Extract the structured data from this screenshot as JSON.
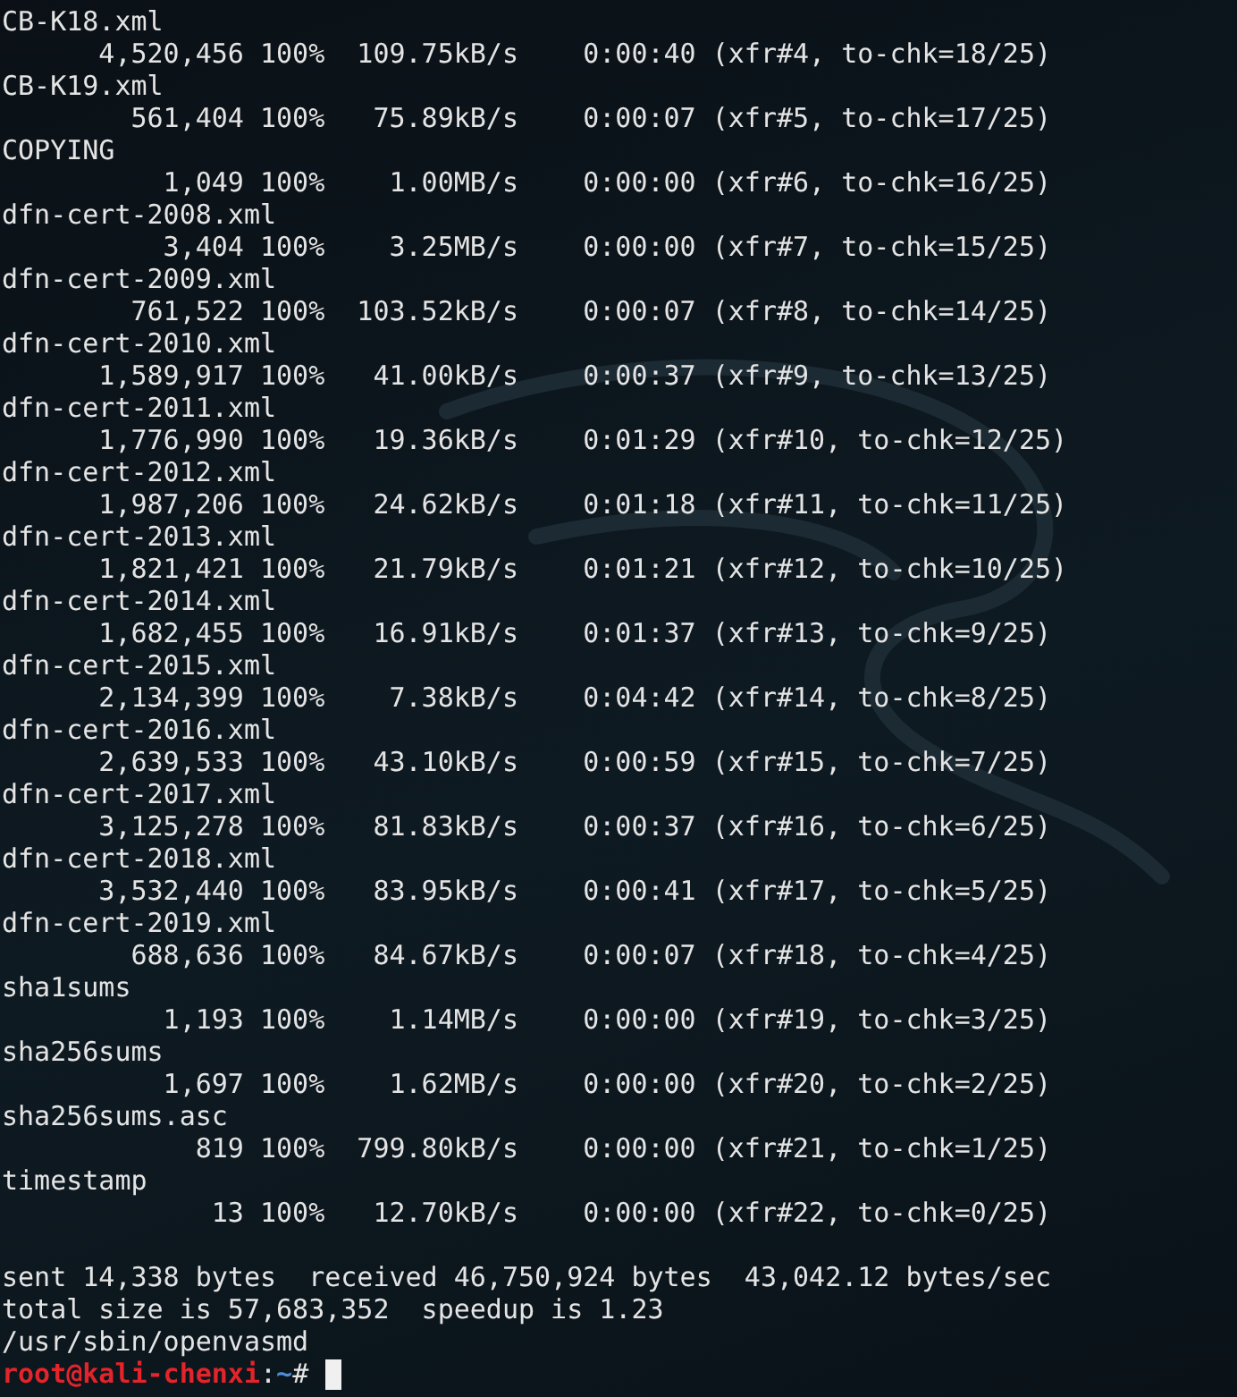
{
  "terminal": {
    "lines": [
      {
        "kind": "text",
        "text": "CB-K18.xml"
      },
      {
        "kind": "text",
        "text": "      4,520,456 100%  109.75kB/s    0:00:40 (xfr#4, to-chk=18/25)"
      },
      {
        "kind": "text",
        "text": "CB-K19.xml"
      },
      {
        "kind": "text",
        "text": "        561,404 100%   75.89kB/s    0:00:07 (xfr#5, to-chk=17/25)"
      },
      {
        "kind": "text",
        "text": "COPYING"
      },
      {
        "kind": "text",
        "text": "          1,049 100%    1.00MB/s    0:00:00 (xfr#6, to-chk=16/25)"
      },
      {
        "kind": "text",
        "text": "dfn-cert-2008.xml"
      },
      {
        "kind": "text",
        "text": "          3,404 100%    3.25MB/s    0:00:00 (xfr#7, to-chk=15/25)"
      },
      {
        "kind": "text",
        "text": "dfn-cert-2009.xml"
      },
      {
        "kind": "text",
        "text": "        761,522 100%  103.52kB/s    0:00:07 (xfr#8, to-chk=14/25)"
      },
      {
        "kind": "text",
        "text": "dfn-cert-2010.xml"
      },
      {
        "kind": "text",
        "text": "      1,589,917 100%   41.00kB/s    0:00:37 (xfr#9, to-chk=13/25)"
      },
      {
        "kind": "text",
        "text": "dfn-cert-2011.xml"
      },
      {
        "kind": "text",
        "text": "      1,776,990 100%   19.36kB/s    0:01:29 (xfr#10, to-chk=12/25)"
      },
      {
        "kind": "text",
        "text": "dfn-cert-2012.xml"
      },
      {
        "kind": "text",
        "text": "      1,987,206 100%   24.62kB/s    0:01:18 (xfr#11, to-chk=11/25)"
      },
      {
        "kind": "text",
        "text": "dfn-cert-2013.xml"
      },
      {
        "kind": "text",
        "text": "      1,821,421 100%   21.79kB/s    0:01:21 (xfr#12, to-chk=10/25)"
      },
      {
        "kind": "text",
        "text": "dfn-cert-2014.xml"
      },
      {
        "kind": "text",
        "text": "      1,682,455 100%   16.91kB/s    0:01:37 (xfr#13, to-chk=9/25)"
      },
      {
        "kind": "text",
        "text": "dfn-cert-2015.xml"
      },
      {
        "kind": "text",
        "text": "      2,134,399 100%    7.38kB/s    0:04:42 (xfr#14, to-chk=8/25)"
      },
      {
        "kind": "text",
        "text": "dfn-cert-2016.xml"
      },
      {
        "kind": "text",
        "text": "      2,639,533 100%   43.10kB/s    0:00:59 (xfr#15, to-chk=7/25)"
      },
      {
        "kind": "text",
        "text": "dfn-cert-2017.xml"
      },
      {
        "kind": "text",
        "text": "      3,125,278 100%   81.83kB/s    0:00:37 (xfr#16, to-chk=6/25)"
      },
      {
        "kind": "text",
        "text": "dfn-cert-2018.xml"
      },
      {
        "kind": "text",
        "text": "      3,532,440 100%   83.95kB/s    0:00:41 (xfr#17, to-chk=5/25)"
      },
      {
        "kind": "text",
        "text": "dfn-cert-2019.xml"
      },
      {
        "kind": "text",
        "text": "        688,636 100%   84.67kB/s    0:00:07 (xfr#18, to-chk=4/25)"
      },
      {
        "kind": "text",
        "text": "sha1sums"
      },
      {
        "kind": "text",
        "text": "          1,193 100%    1.14MB/s    0:00:00 (xfr#19, to-chk=3/25)"
      },
      {
        "kind": "text",
        "text": "sha256sums"
      },
      {
        "kind": "text",
        "text": "          1,697 100%    1.62MB/s    0:00:00 (xfr#20, to-chk=2/25)"
      },
      {
        "kind": "text",
        "text": "sha256sums.asc"
      },
      {
        "kind": "text",
        "text": "            819 100%  799.80kB/s    0:00:00 (xfr#21, to-chk=1/25)"
      },
      {
        "kind": "text",
        "text": "timestamp"
      },
      {
        "kind": "text",
        "text": "             13 100%   12.70kB/s    0:00:00 (xfr#22, to-chk=0/25)"
      },
      {
        "kind": "blank"
      },
      {
        "kind": "text",
        "text": "sent 14,338 bytes  received 46,750,924 bytes  43,042.12 bytes/sec"
      },
      {
        "kind": "text",
        "text": "total size is 57,683,352  speedup is 1.23"
      },
      {
        "kind": "text",
        "text": "/usr/sbin/openvasmd"
      }
    ],
    "prompt": {
      "user_host": "root@kali-chenxi",
      "separator": ":",
      "path": "~",
      "symbol": "#"
    }
  }
}
